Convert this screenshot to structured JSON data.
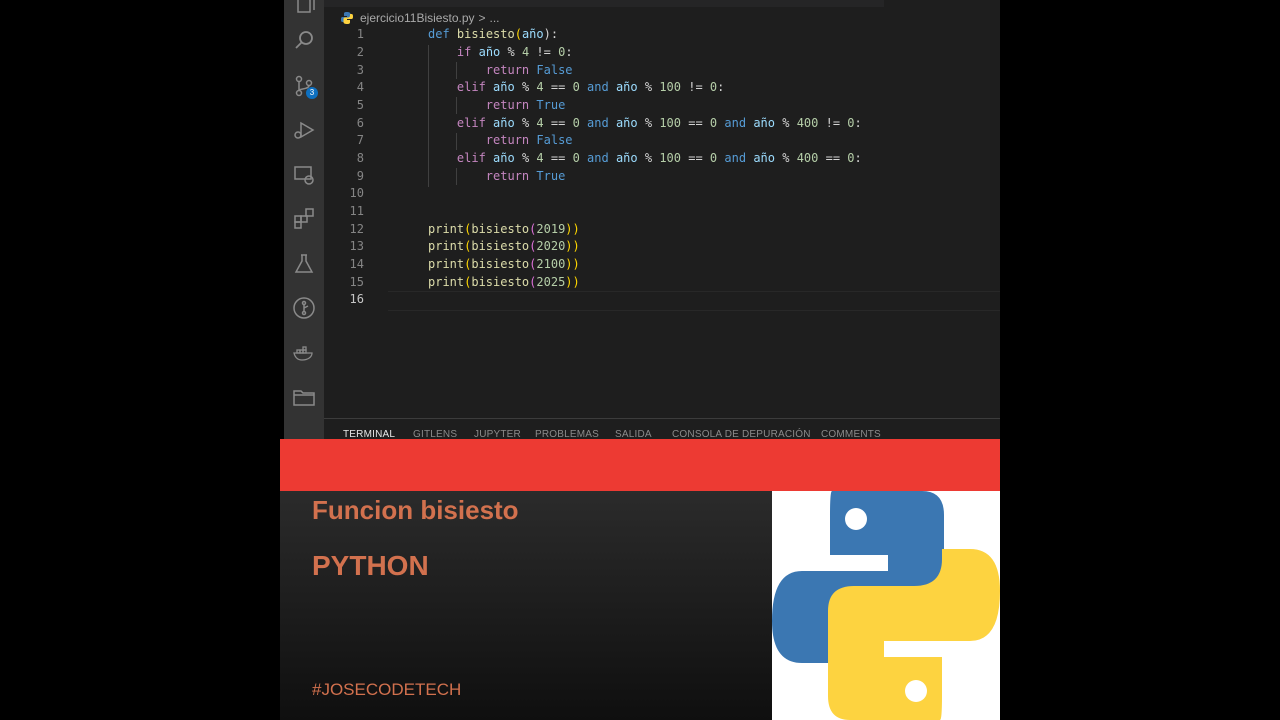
{
  "editor": {
    "breadcrumb_file": "ejercicio11Bisiesto.py",
    "breadcrumb_sep": ">",
    "breadcrumb_more": "...",
    "line_numbers": [
      "1",
      "2",
      "3",
      "4",
      "5",
      "6",
      "7",
      "8",
      "9",
      "10",
      "11",
      "12",
      "13",
      "14",
      "15",
      "16"
    ],
    "code": {
      "l1_def": "def",
      "l1_name": "bisiesto",
      "l1_open": "(",
      "l1_param": "año",
      "l1_close": "):",
      "l2_if": "if",
      "l2_var": "año",
      "l2_rest": " % ",
      "l2_num": "4",
      "l2_cmp": " != ",
      "l2_zero": "0",
      "l2_colon": ":",
      "l3_return": "return",
      "l3_val": "False",
      "l4_elif": "elif",
      "l4_var": "año",
      "l4_a": " % ",
      "l4_n4": "4",
      "l4_b": " == ",
      "l4_z": "0",
      "l4_and": "and",
      "l4_var2": "año",
      "l4_c": " % ",
      "l4_n100": "100",
      "l4_d": " != ",
      "l4_z2": "0",
      "l4_colon": ":",
      "l5_return": "return",
      "l5_val": "True",
      "l6_elif": "elif",
      "l6_var": "año",
      "l6_a": " % ",
      "l6_n4": "4",
      "l6_b": " == ",
      "l6_z": "0",
      "l6_and": "and",
      "l6_var2": "año",
      "l6_c": " % ",
      "l6_n100": "100",
      "l6_d": " == ",
      "l6_z2": "0",
      "l6_and2": "and",
      "l6_var3": "año",
      "l6_e": " % ",
      "l6_n400": "400",
      "l6_f": " != ",
      "l6_z3": "0",
      "l6_colon": ":",
      "l7_return": "return",
      "l7_val": "False",
      "l8_elif": "elif",
      "l8_var": "año",
      "l8_a": " % ",
      "l8_n4": "4",
      "l8_b": " == ",
      "l8_z": "0",
      "l8_and": "and",
      "l8_var2": "año",
      "l8_c": " % ",
      "l8_n100": "100",
      "l8_d": " == ",
      "l8_z2": "0",
      "l8_and2": "and",
      "l8_var3": "año",
      "l8_e": " % ",
      "l8_n400": "400",
      "l8_f": " == ",
      "l8_z3": "0",
      "l8_colon": ":",
      "l9_return": "return",
      "l9_val": "True",
      "print_fn": "print",
      "bisiesto_fn": "bisiesto",
      "open_paren": "(",
      "close_parens": "))",
      "years": [
        "2019",
        "2020",
        "2100",
        "2025"
      ]
    }
  },
  "activity_bar": {
    "icons": [
      "explorer-icon",
      "search-icon",
      "source-control-icon",
      "run-debug-icon",
      "remote-explorer-icon",
      "extensions-icon",
      "testing-icon",
      "gitlens-icon",
      "docker-icon",
      "folder-icon"
    ],
    "scm_badge": "3"
  },
  "panel": {
    "tabs": [
      "TERMINAL",
      "GITLENS",
      "JUPYTER",
      "PROBLEMAS",
      "SALIDA",
      "CONSOLA DE DEPURACIÓN",
      "COMMENTS"
    ]
  },
  "banner": {
    "title": "Funcion bisiesto",
    "language": "PYTHON",
    "hashtag": "#JOSECODETECH"
  },
  "colors": {
    "red_bar": "#ed3a33",
    "banner_text": "#d2714e",
    "python_blue": "#3b77b2",
    "python_yellow": "#fdd340"
  }
}
